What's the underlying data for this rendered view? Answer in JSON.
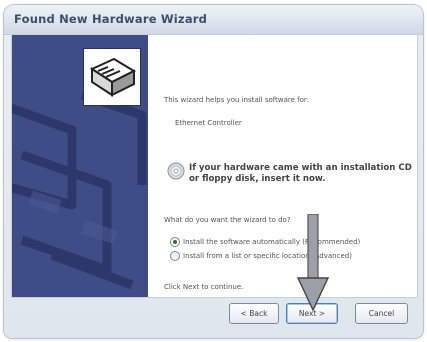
{
  "window": {
    "title": "Found New Hardware Wizard"
  },
  "content": {
    "intro": "This wizard helps you install software for:",
    "device": "Ethernet Controller",
    "cd_notice": "If your hardware came with an installation CD or floppy disk, insert it now.",
    "question": "What do you want the wizard to do?",
    "options": [
      {
        "label": "Install the software automatically (Recommended)",
        "selected": true
      },
      {
        "label": "Install from a list or specific location (Advanced)",
        "selected": false
      }
    ],
    "continue_hint": "Click Next to continue."
  },
  "buttons": {
    "back": "< Back",
    "next": "Next >",
    "cancel": "Cancel"
  },
  "icons": {
    "sidebar_icon": "hardware-wizard-icon",
    "cd": "cd-icon",
    "pointer": "down-arrow-icon"
  },
  "colors": {
    "sidebar": "#3f4d86",
    "title_text": "#3a4f68"
  }
}
